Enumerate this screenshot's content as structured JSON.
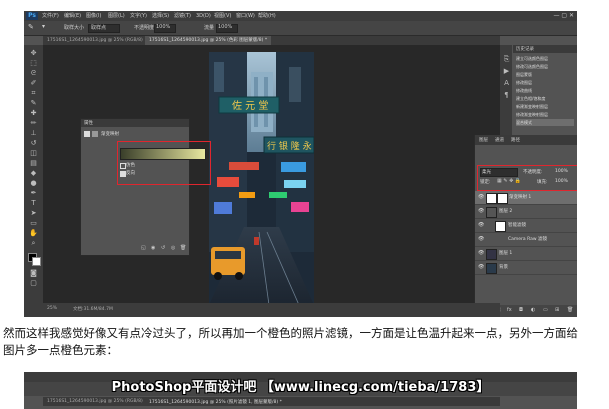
{
  "menubar": {
    "logo": "Ps",
    "items": [
      "文件(F)",
      "编辑(E)",
      "图像(I)",
      "图层(L)",
      "文字(Y)",
      "选择(S)",
      "滤镜(T)",
      "3D(D)",
      "视图(V)",
      "窗口(W)",
      "帮助(H)"
    ],
    "window_controls": "— ▢ ✕"
  },
  "options_bar": {
    "sample_label": "取样大小",
    "sample_value": "取样点",
    "opacity_label": "不透明度",
    "opacity_value": "100%",
    "flow_label": "流量",
    "flow_value": "100%"
  },
  "tabs": [
    {
      "label": "17516S1_1264590013.jpg @ 25% (RGB/8)",
      "active": false
    },
    {
      "label": "17516S1_1264590013.jpg @ 25% (色彩 图层蒙版/8) *",
      "active": true
    }
  ],
  "status_bar": {
    "zoom": "25%",
    "doc": "文档:31.6M/84.7M"
  },
  "properties_panel": {
    "title": "属性",
    "type_label": "渐变映射",
    "dither_label": "仿色",
    "reverse_label": "反向"
  },
  "history_panel": {
    "title": "历史记录",
    "items": [
      "建立可选颜色图层",
      "修改可选颜色图层",
      "图层蒙版",
      "修改图层",
      "修改曲线",
      "建立色相/饱和度",
      "新建渐变映射图层",
      "修改渐变映射图层",
      "混合模式"
    ]
  },
  "layers_panel": {
    "tabs": [
      "图层",
      "通道",
      "路径"
    ],
    "blend_mode": "柔光",
    "opacity_label": "不透明度:",
    "opacity_value": "100%",
    "lock_label": "锁定:",
    "fill_label": "填充:",
    "fill_value": "100%",
    "layers": [
      {
        "name": "渐变映射 1",
        "selected": true
      },
      {
        "name": "图层 2",
        "selected": false
      },
      {
        "name": "智能滤镜",
        "selected": false
      },
      {
        "name": "Camera Raw 滤镜",
        "selected": false
      },
      {
        "name": "图层 1",
        "selected": false
      },
      {
        "name": "背景",
        "selected": false
      }
    ]
  },
  "caption": {
    "line1": "然而这样我感觉好像又有点冷过头了，所以再加一个橙色的照片滤镜，一方面是让色温升起来一点，另外一方面给",
    "line2": "图片多一点橙色元素："
  },
  "second_screenshot": {
    "watermark": "PhotoShop平面设计吧 【www.linecg.com/tieba/1783】",
    "tab1": "17516S1_1264590013.jpg @ 25% (RGB/8)",
    "tab2": "17516S1_1264590013.jpg @ 25% (照片滤镜 1, 图层蒙版/8) *"
  },
  "photo_signs": {
    "sign_top": "佐 元 堂",
    "sign_mid": "行 银 隆 永"
  },
  "colors": {
    "ps_bg": "#535353",
    "panel_dark": "#3c3c3c",
    "highlight_red": "#e0262e",
    "gradient_start": "#3a3f2a",
    "gradient_end": "#e8e8a0"
  }
}
